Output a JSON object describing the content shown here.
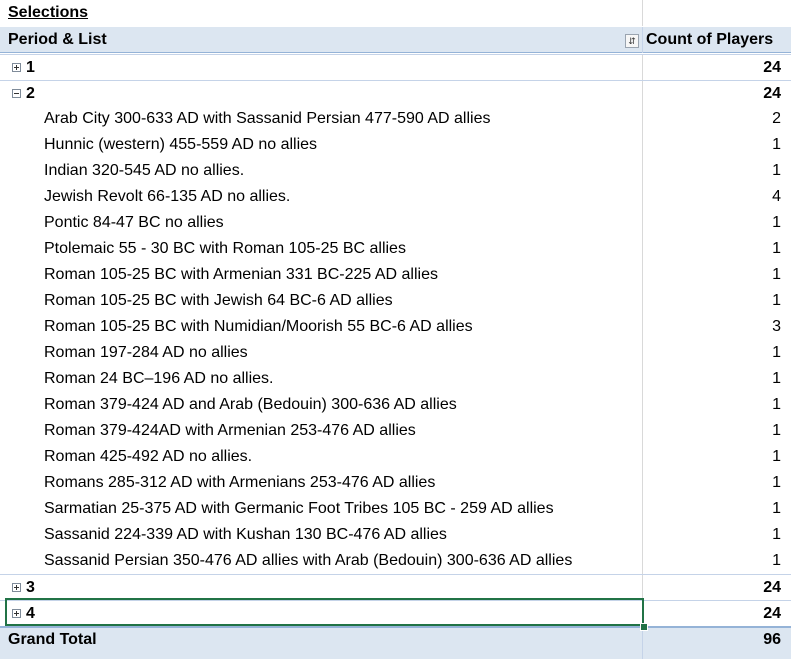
{
  "sheet_title": "Selections",
  "header": {
    "row_label": "Period & List",
    "value_label": "Count of Players"
  },
  "groups": [
    {
      "label": "1",
      "count": "24",
      "expanded": false
    },
    {
      "label": "2",
      "count": "24",
      "expanded": true,
      "items": [
        {
          "name": "Arab City 300-633 AD with Sassanid Persian 477-590 AD allies",
          "count": "2"
        },
        {
          "name": "Hunnic (western) 455-559 AD no allies",
          "count": "1"
        },
        {
          "name": "Indian 320-545 AD no allies.",
          "count": "1"
        },
        {
          "name": "Jewish Revolt 66-135 AD no allies.",
          "count": "4"
        },
        {
          "name": "Pontic 84-47 BC no allies",
          "count": "1"
        },
        {
          "name": "Ptolemaic 55 - 30 BC with Roman 105-25 BC allies",
          "count": "1"
        },
        {
          "name": "Roman 105-25 BC with Armenian 331 BC-225 AD allies",
          "count": "1"
        },
        {
          "name": "Roman 105-25 BC with Jewish 64 BC-6 AD allies",
          "count": "1"
        },
        {
          "name": "Roman 105-25 BC with Numidian/Moorish 55 BC-6 AD allies",
          "count": "3"
        },
        {
          "name": "Roman 197-284 AD no allies",
          "count": "1"
        },
        {
          "name": "Roman 24 BC–196 AD no allies.",
          "count": "1"
        },
        {
          "name": "Roman 379-424 AD and Arab (Bedouin) 300-636 AD allies",
          "count": "1"
        },
        {
          "name": "Roman 379-424AD with Armenian 253-476 AD allies",
          "count": "1"
        },
        {
          "name": "Roman 425-492 AD no allies.",
          "count": "1"
        },
        {
          "name": "Romans 285-312 AD with Armenians 253-476 AD allies",
          "count": "1"
        },
        {
          "name": "Sarmatian 25-375 AD with Germanic Foot Tribes 105 BC - 259 AD allies",
          "count": "1"
        },
        {
          "name": "Sassanid 224-339 AD with Kushan 130 BC-476 AD allies",
          "count": "1"
        },
        {
          "name": "Sassanid Persian 350-476 AD allies with Arab (Bedouin) 300-636 AD allies",
          "count": "1"
        }
      ]
    },
    {
      "label": "3",
      "count": "24",
      "expanded": false
    },
    {
      "label": "4",
      "count": "24",
      "expanded": false
    }
  ],
  "grand_total": {
    "label": "Grand Total",
    "count": "96"
  },
  "filter_icon": "sort-filter-icon"
}
